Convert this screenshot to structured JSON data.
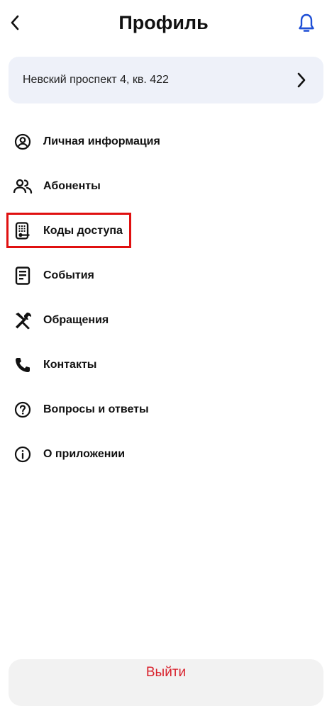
{
  "header": {
    "title": "Профиль",
    "back_icon": "chevron-left-icon",
    "bell_icon": "bell-icon"
  },
  "address": {
    "text": "Невский проспект 4, кв. 422",
    "chevron_icon": "chevron-right-icon"
  },
  "menu": {
    "items": [
      {
        "label": "Личная информация",
        "icon": "user-circle-icon"
      },
      {
        "label": "Абоненты",
        "icon": "users-icon"
      },
      {
        "label": "Коды доступа",
        "icon": "keypad-icon"
      },
      {
        "label": "События",
        "icon": "document-icon"
      },
      {
        "label": "Обращения",
        "icon": "tools-icon"
      },
      {
        "label": "Контакты",
        "icon": "phone-icon"
      },
      {
        "label": "Вопросы и ответы",
        "icon": "question-icon"
      },
      {
        "label": "О приложении",
        "icon": "info-icon"
      }
    ]
  },
  "logout": {
    "label": "Выйти"
  },
  "colors": {
    "accent": "#1e4fd6",
    "danger": "#d9232e",
    "highlight": "#e01010",
    "card_bg": "#eef1f9"
  }
}
